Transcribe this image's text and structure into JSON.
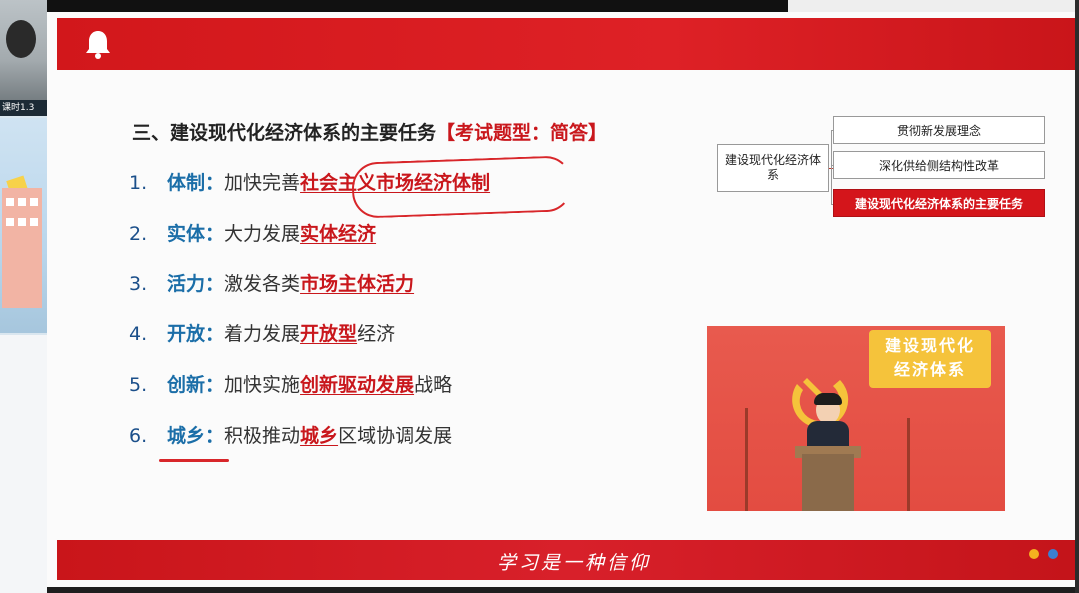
{
  "webcam": {
    "caption": "课时1.3"
  },
  "slide": {
    "heading": "三、建设现代化经济体系的主要任务",
    "heading_tag": "【考试题型：简答】",
    "items": [
      {
        "num": "1.",
        "key": "体制",
        "sep": "：",
        "text": "加快完善",
        "highlight": "社会主义市场经济体制",
        "suffix": ""
      },
      {
        "num": "2.",
        "key": "实体",
        "sep": "：",
        "text": "大力发展",
        "highlight": "实体经济",
        "suffix": ""
      },
      {
        "num": "3.",
        "key": "活力",
        "sep": "：",
        "text": "激发各类",
        "highlight": "市场主体活力",
        "suffix": ""
      },
      {
        "num": "4.",
        "key": "开放",
        "sep": "：",
        "text": "着力发展",
        "highlight": "开放型",
        "suffix": "经济"
      },
      {
        "num": "5.",
        "key": "创新",
        "sep": "：",
        "text": "加快实施",
        "highlight": "创新驱动发展",
        "suffix": "战略"
      },
      {
        "num": "6.",
        "key": "城乡",
        "sep": "：",
        "text": "积极推动",
        "highlight": "城乡",
        "suffix": "区域协调发展"
      }
    ],
    "mindmap": {
      "root": "建设现代化经济体系",
      "nodes": [
        {
          "label": "贯彻新发展理念",
          "active": false
        },
        {
          "label": "深化供给侧结构性改革",
          "active": false
        },
        {
          "label": "建设现代化经济体系的主要任务",
          "active": true
        }
      ]
    },
    "illustration": {
      "caption_line1": "建设现代化",
      "caption_line2": "经济体系"
    },
    "footer": {
      "slogan": "学习是一种信仰"
    }
  },
  "colors": {
    "brand_red": "#d4151b",
    "item_blue": "#1b6ea8",
    "highlight_red": "#c9171c"
  }
}
